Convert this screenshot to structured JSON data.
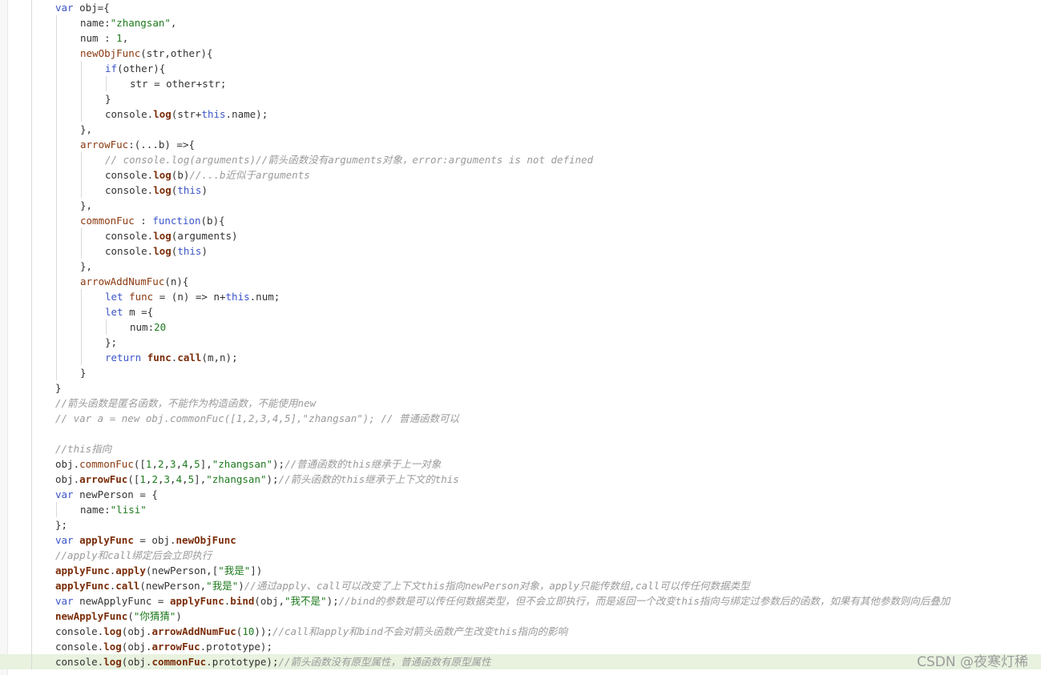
{
  "editor": {
    "lines": [
      {
        "indent": 1,
        "tokens": [
          {
            "c": "kw",
            "t": "var"
          },
          {
            "c": "pl",
            "t": " obj={"
          }
        ]
      },
      {
        "indent": 2,
        "tokens": [
          {
            "c": "pl",
            "t": "name:"
          },
          {
            "c": "str",
            "t": "\"zhangsan\""
          },
          {
            "c": "pl",
            "t": ","
          }
        ]
      },
      {
        "indent": 2,
        "tokens": [
          {
            "c": "pl",
            "t": "num : "
          },
          {
            "c": "num",
            "t": "1"
          },
          {
            "c": "pl",
            "t": ","
          }
        ]
      },
      {
        "indent": 2,
        "tokens": [
          {
            "c": "fnp",
            "t": "newObjFunc"
          },
          {
            "c": "pl",
            "t": "(str,other){"
          }
        ]
      },
      {
        "indent": 3,
        "tokens": [
          {
            "c": "kw",
            "t": "if"
          },
          {
            "c": "pl",
            "t": "(other){"
          }
        ]
      },
      {
        "indent": 4,
        "tokens": [
          {
            "c": "pl",
            "t": "str = other+str;"
          }
        ]
      },
      {
        "indent": 3,
        "tokens": [
          {
            "c": "pl",
            "t": "}"
          }
        ]
      },
      {
        "indent": 3,
        "tokens": [
          {
            "c": "pl",
            "t": "console."
          },
          {
            "c": "fn",
            "t": "log"
          },
          {
            "c": "pl",
            "t": "(str+"
          },
          {
            "c": "kw",
            "t": "this"
          },
          {
            "c": "pl",
            "t": ".name);"
          }
        ]
      },
      {
        "indent": 2,
        "tokens": [
          {
            "c": "pl",
            "t": "},"
          }
        ]
      },
      {
        "indent": 2,
        "tokens": [
          {
            "c": "fnp",
            "t": "arrowFuc"
          },
          {
            "c": "pl",
            "t": ":(...b) =>{"
          }
        ]
      },
      {
        "indent": 3,
        "tokens": [
          {
            "c": "cm",
            "t": "// console.log(arguments)//箭头函数没有arguments对象，error:arguments is not defined"
          }
        ]
      },
      {
        "indent": 3,
        "tokens": [
          {
            "c": "pl",
            "t": "console."
          },
          {
            "c": "fn",
            "t": "log"
          },
          {
            "c": "pl",
            "t": "(b)"
          },
          {
            "c": "cm",
            "t": "//...b近似于arguments"
          }
        ]
      },
      {
        "indent": 3,
        "tokens": [
          {
            "c": "pl",
            "t": "console."
          },
          {
            "c": "fn",
            "t": "log"
          },
          {
            "c": "pl",
            "t": "("
          },
          {
            "c": "kw",
            "t": "this"
          },
          {
            "c": "pl",
            "t": ")"
          }
        ]
      },
      {
        "indent": 2,
        "tokens": [
          {
            "c": "pl",
            "t": "},"
          }
        ]
      },
      {
        "indent": 2,
        "tokens": [
          {
            "c": "fnp",
            "t": "commonFuc"
          },
          {
            "c": "pl",
            "t": " : "
          },
          {
            "c": "kw",
            "t": "function"
          },
          {
            "c": "pl",
            "t": "(b){"
          }
        ]
      },
      {
        "indent": 3,
        "tokens": [
          {
            "c": "pl",
            "t": "console."
          },
          {
            "c": "fn",
            "t": "log"
          },
          {
            "c": "pl",
            "t": "(arguments)"
          }
        ]
      },
      {
        "indent": 3,
        "tokens": [
          {
            "c": "pl",
            "t": "console."
          },
          {
            "c": "fn",
            "t": "log"
          },
          {
            "c": "pl",
            "t": "("
          },
          {
            "c": "kw",
            "t": "this"
          },
          {
            "c": "pl",
            "t": ")"
          }
        ]
      },
      {
        "indent": 2,
        "tokens": [
          {
            "c": "pl",
            "t": "},"
          }
        ]
      },
      {
        "indent": 2,
        "tokens": [
          {
            "c": "fnp",
            "t": "arrowAddNumFuc"
          },
          {
            "c": "pl",
            "t": "(n){"
          }
        ]
      },
      {
        "indent": 3,
        "tokens": [
          {
            "c": "kw",
            "t": "let"
          },
          {
            "c": "pl",
            "t": " "
          },
          {
            "c": "fnp",
            "t": "func"
          },
          {
            "c": "pl",
            "t": " = (n) => n+"
          },
          {
            "c": "kw",
            "t": "this"
          },
          {
            "c": "pl",
            "t": ".num;"
          }
        ]
      },
      {
        "indent": 3,
        "tokens": [
          {
            "c": "kw",
            "t": "let"
          },
          {
            "c": "pl",
            "t": " m ={"
          }
        ]
      },
      {
        "indent": 4,
        "tokens": [
          {
            "c": "pl",
            "t": "num:"
          },
          {
            "c": "num",
            "t": "20"
          }
        ]
      },
      {
        "indent": 3,
        "tokens": [
          {
            "c": "pl",
            "t": "};"
          }
        ]
      },
      {
        "indent": 3,
        "tokens": [
          {
            "c": "kw",
            "t": "return"
          },
          {
            "c": "pl",
            "t": " "
          },
          {
            "c": "fn",
            "t": "func"
          },
          {
            "c": "pl",
            "t": "."
          },
          {
            "c": "fn",
            "t": "call"
          },
          {
            "c": "pl",
            "t": "(m,n);"
          }
        ]
      },
      {
        "indent": 2,
        "tokens": [
          {
            "c": "pl",
            "t": "}"
          }
        ]
      },
      {
        "indent": 1,
        "tokens": [
          {
            "c": "pl",
            "t": "}"
          }
        ]
      },
      {
        "indent": 1,
        "tokens": [
          {
            "c": "cm",
            "t": "//箭头函数是匿名函数，不能作为构造函数，不能使用new"
          }
        ]
      },
      {
        "indent": 1,
        "tokens": [
          {
            "c": "cm",
            "t": "// var a = new obj.commonFuc([1,2,3,4,5],\"zhangsan\"); // 普通函数可以"
          }
        ]
      },
      {
        "indent": 1,
        "tokens": []
      },
      {
        "indent": 1,
        "tokens": [
          {
            "c": "cm",
            "t": "//this指向"
          }
        ]
      },
      {
        "indent": 1,
        "tokens": [
          {
            "c": "pl",
            "t": "obj."
          },
          {
            "c": "fnp",
            "t": "commonFuc"
          },
          {
            "c": "pl",
            "t": "(["
          },
          {
            "c": "num",
            "t": "1"
          },
          {
            "c": "pl",
            "t": ","
          },
          {
            "c": "num",
            "t": "2"
          },
          {
            "c": "pl",
            "t": ","
          },
          {
            "c": "num",
            "t": "3"
          },
          {
            "c": "pl",
            "t": ","
          },
          {
            "c": "num",
            "t": "4"
          },
          {
            "c": "pl",
            "t": ","
          },
          {
            "c": "num",
            "t": "5"
          },
          {
            "c": "pl",
            "t": "],"
          },
          {
            "c": "str",
            "t": "\"zhangsan\""
          },
          {
            "c": "pl",
            "t": ");"
          },
          {
            "c": "cm",
            "t": "//普通函数的this继承于上一对象"
          }
        ]
      },
      {
        "indent": 1,
        "tokens": [
          {
            "c": "pl",
            "t": "obj."
          },
          {
            "c": "fn",
            "t": "arrowFuc"
          },
          {
            "c": "pl",
            "t": "(["
          },
          {
            "c": "num",
            "t": "1"
          },
          {
            "c": "pl",
            "t": ","
          },
          {
            "c": "num",
            "t": "2"
          },
          {
            "c": "pl",
            "t": ","
          },
          {
            "c": "num",
            "t": "3"
          },
          {
            "c": "pl",
            "t": ","
          },
          {
            "c": "num",
            "t": "4"
          },
          {
            "c": "pl",
            "t": ","
          },
          {
            "c": "num",
            "t": "5"
          },
          {
            "c": "pl",
            "t": "],"
          },
          {
            "c": "str",
            "t": "\"zhangsan\""
          },
          {
            "c": "pl",
            "t": ");"
          },
          {
            "c": "cm",
            "t": "//箭头函数的this继承于上下文的this"
          }
        ]
      },
      {
        "indent": 1,
        "tokens": [
          {
            "c": "kw",
            "t": "var"
          },
          {
            "c": "pl",
            "t": " newPerson = {"
          }
        ]
      },
      {
        "indent": 2,
        "tokens": [
          {
            "c": "pl",
            "t": "name:"
          },
          {
            "c": "str",
            "t": "\"lisi\""
          }
        ]
      },
      {
        "indent": 1,
        "tokens": [
          {
            "c": "pl",
            "t": "};"
          }
        ]
      },
      {
        "indent": 1,
        "tokens": [
          {
            "c": "kw",
            "t": "var"
          },
          {
            "c": "pl",
            "t": " "
          },
          {
            "c": "fn",
            "t": "applyFunc"
          },
          {
            "c": "pl",
            "t": " = obj."
          },
          {
            "c": "fn",
            "t": "newObjFunc"
          }
        ]
      },
      {
        "indent": 1,
        "tokens": [
          {
            "c": "cm",
            "t": "//apply和call绑定后会立即执行"
          }
        ]
      },
      {
        "indent": 1,
        "tokens": [
          {
            "c": "fn",
            "t": "applyFunc"
          },
          {
            "c": "pl",
            "t": "."
          },
          {
            "c": "fn",
            "t": "apply"
          },
          {
            "c": "pl",
            "t": "(newPerson,["
          },
          {
            "c": "str",
            "t": "\"我是\""
          },
          {
            "c": "pl",
            "t": "])"
          }
        ]
      },
      {
        "indent": 1,
        "tokens": [
          {
            "c": "fn",
            "t": "applyFunc"
          },
          {
            "c": "pl",
            "t": "."
          },
          {
            "c": "fn",
            "t": "call"
          },
          {
            "c": "pl",
            "t": "(newPerson,"
          },
          {
            "c": "str",
            "t": "\"我是\""
          },
          {
            "c": "pl",
            "t": ")"
          },
          {
            "c": "cm",
            "t": "//通过apply、call可以改变了上下文this指向newPerson对象，apply只能传数组,call可以传任何数据类型"
          }
        ]
      },
      {
        "indent": 1,
        "tokens": [
          {
            "c": "kw",
            "t": "var"
          },
          {
            "c": "pl",
            "t": " newApplyFunc = "
          },
          {
            "c": "fn",
            "t": "applyFunc"
          },
          {
            "c": "pl",
            "t": "."
          },
          {
            "c": "fn",
            "t": "bind"
          },
          {
            "c": "pl",
            "t": "(obj,"
          },
          {
            "c": "str",
            "t": "\"我不是\""
          },
          {
            "c": "pl",
            "t": ");"
          },
          {
            "c": "cm",
            "t": "//bind的参数是可以传任何数据类型，但不会立即执行，而是返回一个改变this指向与绑定过参数后的函数，如果有其他参数则向后叠加"
          }
        ]
      },
      {
        "indent": 1,
        "tokens": [
          {
            "c": "fn",
            "t": "newApplyFunc"
          },
          {
            "c": "pl",
            "t": "("
          },
          {
            "c": "str",
            "t": "\"你猜猜\""
          },
          {
            "c": "pl",
            "t": ")"
          }
        ]
      },
      {
        "indent": 1,
        "tokens": [
          {
            "c": "pl",
            "t": "console."
          },
          {
            "c": "fn",
            "t": "log"
          },
          {
            "c": "pl",
            "t": "(obj."
          },
          {
            "c": "fn",
            "t": "arrowAddNumFuc"
          },
          {
            "c": "pl",
            "t": "("
          },
          {
            "c": "num",
            "t": "10"
          },
          {
            "c": "pl",
            "t": "));"
          },
          {
            "c": "cm",
            "t": "//call和apply和bind不会对箭头函数产生改变this指向的影响"
          }
        ]
      },
      {
        "indent": 1,
        "tokens": [
          {
            "c": "pl",
            "t": "console."
          },
          {
            "c": "fn",
            "t": "log"
          },
          {
            "c": "pl",
            "t": "(obj."
          },
          {
            "c": "fn",
            "t": "arrowFuc"
          },
          {
            "c": "pl",
            "t": ".prototype);"
          }
        ]
      },
      {
        "indent": 1,
        "current": true,
        "tokens": [
          {
            "c": "pl",
            "t": "console."
          },
          {
            "c": "fn",
            "t": "log"
          },
          {
            "c": "pl",
            "t": "(obj."
          },
          {
            "c": "fn",
            "t": "commonFuc"
          },
          {
            "c": "pl",
            "t": ".prototype);"
          },
          {
            "c": "cm",
            "t": "//箭头函数没有原型属性，普通函数有原型属性"
          }
        ]
      }
    ]
  },
  "watermark": {
    "text": "CSDN @夜寒灯稀"
  }
}
